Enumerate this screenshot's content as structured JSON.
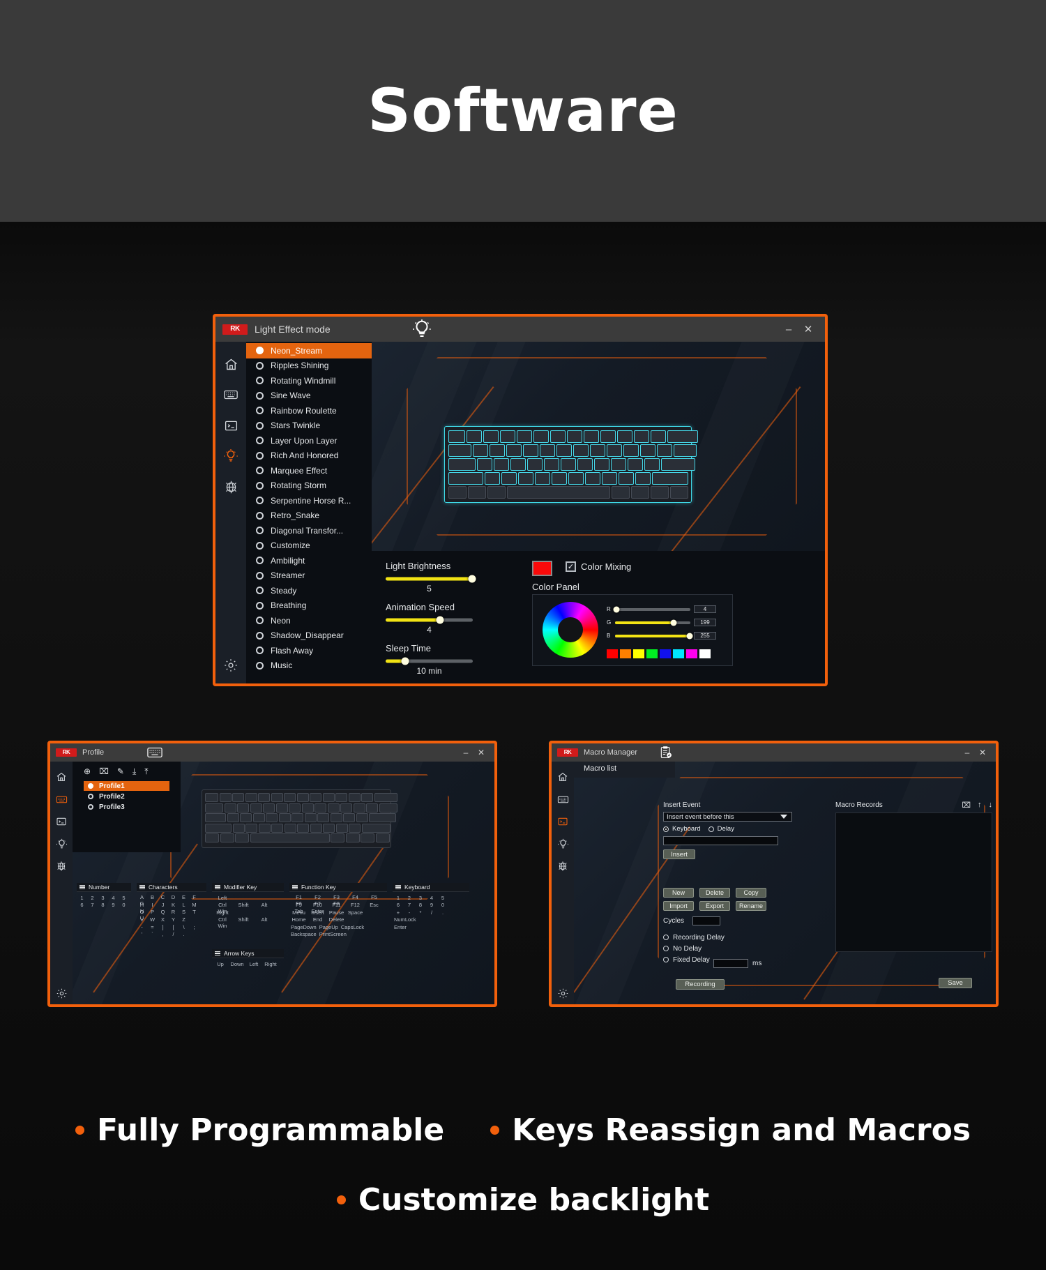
{
  "hero": {
    "title": "Software"
  },
  "light_window": {
    "titlebar": {
      "logo": "RK",
      "title": "Light Effect mode",
      "header_icon": "bulb-icon",
      "minimize": "–",
      "close": "✕"
    },
    "rail": [
      {
        "name": "home-icon",
        "label": "Home"
      },
      {
        "name": "keyboard-icon",
        "label": "Keyboard"
      },
      {
        "name": "macro-icon",
        "label": "Macro"
      },
      {
        "name": "bulb-icon",
        "label": "Light Effect",
        "active": true
      },
      {
        "name": "globe-icon",
        "label": "Web"
      },
      {
        "name": "gear-icon",
        "label": "Settings"
      }
    ],
    "effects": [
      {
        "label": "Neon_Stream",
        "selected": true
      },
      {
        "label": "Ripples Shining",
        "selected": false
      },
      {
        "label": "Rotating Windmill",
        "selected": false
      },
      {
        "label": "Sine Wave",
        "selected": false
      },
      {
        "label": "Rainbow Roulette",
        "selected": false
      },
      {
        "label": "Stars Twinkle",
        "selected": false
      },
      {
        "label": "Layer Upon Layer",
        "selected": false
      },
      {
        "label": "Rich And Honored",
        "selected": false
      },
      {
        "label": "Marquee Effect",
        "selected": false
      },
      {
        "label": "Rotating Storm",
        "selected": false
      },
      {
        "label": "Serpentine Horse R...",
        "selected": false
      },
      {
        "label": "Retro_Snake",
        "selected": false
      },
      {
        "label": "Diagonal Transfor...",
        "selected": false
      },
      {
        "label": "Customize",
        "selected": false
      },
      {
        "label": "Ambilight",
        "selected": false
      },
      {
        "label": "Streamer",
        "selected": false
      },
      {
        "label": "Steady",
        "selected": false
      },
      {
        "label": "Breathing",
        "selected": false
      },
      {
        "label": "Neon",
        "selected": false
      },
      {
        "label": "Shadow_Disappear",
        "selected": false
      },
      {
        "label": "Flash Away",
        "selected": false
      },
      {
        "label": "Music",
        "selected": false
      }
    ],
    "controls": {
      "brightness": {
        "label": "Light Brightness",
        "value": "5",
        "percent": 100
      },
      "speed": {
        "label": "Animation Speed",
        "value": "4",
        "percent": 62
      },
      "sleep": {
        "label": "Sleep Time",
        "value": "10 min",
        "percent": 22
      }
    },
    "color": {
      "current_swatch": "#fa0a0a",
      "mixing_label": "Color Mixing",
      "mixing_checked": true,
      "panel_label": "Color Panel",
      "channels": [
        {
          "ch": "R",
          "value": "4",
          "percent": 2
        },
        {
          "ch": "G",
          "value": "199",
          "percent": 78
        },
        {
          "ch": "B",
          "value": "255",
          "percent": 100
        }
      ],
      "swatches": [
        "#ff0000",
        "#ff8000",
        "#ffff00",
        "#00ee22",
        "#1111ee",
        "#00e5ff",
        "#ff00ee",
        "#ffffff"
      ]
    }
  },
  "profile_window": {
    "titlebar": {
      "logo": "RK",
      "title": "Profile",
      "header_icon": "keyboard-icon",
      "minimize": "–",
      "close": "✕"
    },
    "rail": [
      {
        "name": "home-icon",
        "label": "Home"
      },
      {
        "name": "keyboard-icon",
        "label": "Keyboard",
        "active": true
      },
      {
        "name": "macro-icon",
        "label": "Macro"
      },
      {
        "name": "bulb-icon",
        "label": "Light Effect"
      },
      {
        "name": "globe-icon",
        "label": "Web"
      },
      {
        "name": "gear-icon",
        "label": "Settings"
      }
    ],
    "toolbar": [
      {
        "name": "add-profile-icon",
        "glyph": "⊕"
      },
      {
        "name": "delete-profile-icon",
        "glyph": "⌧"
      },
      {
        "name": "edit-profile-icon",
        "glyph": "✎"
      },
      {
        "name": "import-profile-icon",
        "glyph": "⤓"
      },
      {
        "name": "export-profile-icon",
        "glyph": "⤒"
      }
    ],
    "profiles": [
      {
        "label": "Profile1",
        "selected": true
      },
      {
        "label": "Profile2",
        "selected": false
      },
      {
        "label": "Profile3",
        "selected": false
      }
    ],
    "categories": [
      {
        "title": "Number",
        "rows": [
          [
            "1",
            "2",
            "3",
            "4",
            "5"
          ],
          [
            "6",
            "7",
            "8",
            "9",
            "0"
          ]
        ]
      },
      {
        "title": "Characters",
        "rows": [
          [
            "A",
            "B",
            "C",
            "D",
            "E",
            "F",
            "G"
          ],
          [
            "H",
            "I",
            "J",
            "K",
            "L",
            "M",
            "N"
          ],
          [
            "O",
            "P",
            "Q",
            "R",
            "S",
            "T",
            "U"
          ],
          [
            "V",
            "W",
            "X",
            "Y",
            "Z"
          ],
          [
            "-",
            "=",
            "]",
            "[",
            "\\",
            ";"
          ],
          [
            "'",
            "`",
            ",",
            "/",
            "."
          ]
        ]
      },
      {
        "title": "Modifier Key",
        "rows": [
          [
            "Left"
          ],
          [
            "Ctrl",
            "Shift",
            "Alt",
            "Win"
          ],
          [
            "Right"
          ],
          [
            "Ctrl",
            "Shift",
            "Alt",
            "Win"
          ]
        ]
      },
      {
        "title": "Function Key",
        "rows": [
          [
            "F1",
            "F2",
            "F3",
            "F4",
            "F5",
            "F6",
            "F7",
            "F8"
          ],
          [
            "F9",
            "F10",
            "F11",
            "F12",
            "Esc",
            "Tab",
            "Enter"
          ],
          [
            "Menu",
            "Insert",
            "Pause",
            "Space"
          ],
          [
            "Home",
            "End",
            "Delete"
          ],
          [
            "PageDown",
            "PageUp",
            "CapsLock"
          ],
          [
            "Backspace",
            "PrintScreen"
          ]
        ]
      },
      {
        "title": "Keyboard",
        "rows": [
          [
            "1",
            "2",
            "3",
            "4",
            "5"
          ],
          [
            "6",
            "7",
            "8",
            "9",
            "0"
          ],
          [
            "+",
            "-",
            "*",
            "/",
            "."
          ],
          [
            "NumLock"
          ],
          [
            "Enter"
          ]
        ]
      },
      {
        "title": "Arrow Keys",
        "rows": [
          [
            "Up",
            "Down",
            "Left",
            "Right"
          ]
        ]
      }
    ]
  },
  "macro_window": {
    "titlebar": {
      "logo": "RK",
      "title": "Macro Manager",
      "header_icon": "macro-list-icon",
      "minimize": "–",
      "close": "✕"
    },
    "rail": [
      {
        "name": "home-icon",
        "label": "Home"
      },
      {
        "name": "keyboard-icon",
        "label": "Keyboard"
      },
      {
        "name": "macro-icon",
        "label": "Macro",
        "active": true
      },
      {
        "name": "bulb-icon",
        "label": "Light Effect"
      },
      {
        "name": "globe-icon",
        "label": "Web"
      },
      {
        "name": "gear-icon",
        "label": "Settings"
      }
    ],
    "macro_list_title": "Macro list",
    "insert_event": {
      "label": "Insert Event",
      "select_value": "Insert event before this",
      "radio_keyboard": "Keyboard",
      "radio_delay": "Delay",
      "keyboard_selected": true,
      "input_value": "",
      "insert_button": "Insert"
    },
    "records": {
      "title": "Macro Records",
      "icons": [
        {
          "name": "delete-record-icon",
          "glyph": "⌧"
        },
        {
          "name": "move-up-icon",
          "glyph": "↑"
        },
        {
          "name": "move-down-icon",
          "glyph": "↓"
        }
      ]
    },
    "buttons": [
      [
        "New",
        "Delete",
        "Copy"
      ],
      [
        "Import",
        "Export",
        "Rename"
      ]
    ],
    "cycles": {
      "label": "Cycles",
      "value": ""
    },
    "delay_options": [
      {
        "label": "Recording Delay",
        "selected": false
      },
      {
        "label": "No Delay",
        "selected": false
      },
      {
        "label": "Fixed Delay",
        "selected": false
      }
    ],
    "fixed_delay_value": "",
    "fixed_delay_unit": "ms",
    "recording_button": "Recording",
    "save_button": "Save"
  },
  "bullets": {
    "row1": [
      "Fully Programmable",
      "Keys Reassign and Macros"
    ],
    "row2": [
      "Customize backlight"
    ]
  },
  "colors": {
    "accent": "#f2600c",
    "yellow": "#f2e314",
    "hero_bg": "#3a3a3a"
  }
}
